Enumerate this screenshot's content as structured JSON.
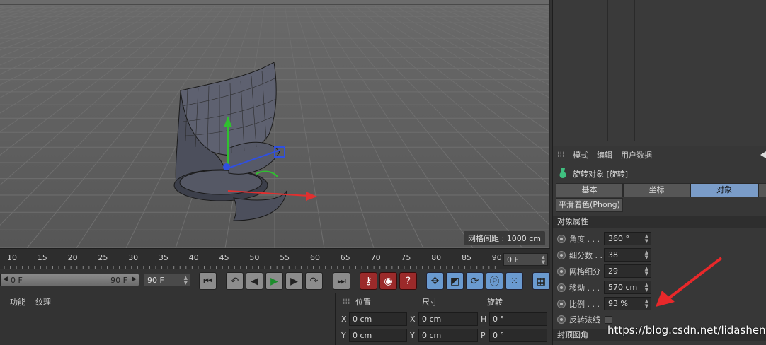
{
  "viewport": {
    "grid_label": "网格间距 : 1000 cm"
  },
  "timeline": {
    "ticks": [
      "10",
      "15",
      "20",
      "25",
      "30",
      "35",
      "40",
      "45",
      "50",
      "55",
      "60",
      "65",
      "70",
      "75",
      "80",
      "85",
      "90"
    ],
    "current_frame": "0 F"
  },
  "transport": {
    "range_start": "0 F",
    "range_end": "90 F",
    "end_frame": "90 F"
  },
  "material_menu": {
    "item1": "功能",
    "item2": "纹理"
  },
  "coordinates": {
    "head_position": "位置",
    "head_size": "尺寸",
    "head_rotation": "旋转",
    "axis_x": "X",
    "axis_y": "Y",
    "axis_h": "H",
    "axis_p": "P",
    "pos_x": "0 cm",
    "pos_y": "0 cm",
    "size_x": "0 cm",
    "size_y": "0 cm",
    "rot_h": "0 °",
    "rot_p": "0 °"
  },
  "attributes": {
    "menu_mode": "模式",
    "menu_edit": "编辑",
    "menu_userdata": "用户数据",
    "object_title": "旋转对象 [旋转]",
    "tab_basic": "基本",
    "tab_coord": "坐标",
    "tab_object": "对象",
    "tab_phong": "平滑着色(Phong)",
    "section_object": "对象属性",
    "section_caps": "封顶圆角",
    "rows": [
      {
        "label": "角度 . . .",
        "value": "360 °"
      },
      {
        "label": "细分数 . .",
        "value": "38"
      },
      {
        "label": "网格细分",
        "value": "29"
      },
      {
        "label": "移动 . . .",
        "value": "570 cm"
      },
      {
        "label": "比例 . . .",
        "value": "93 %"
      }
    ],
    "flip_normals": "反转法线"
  },
  "watermark": "https://blog.csdn.net/lidashent",
  "colors": {
    "active_tab": "#7a9cc8",
    "annotation_arrow": "#e8282a",
    "axis_x": "#e03030",
    "axis_y": "#30c030",
    "axis_z": "#3050e0"
  }
}
